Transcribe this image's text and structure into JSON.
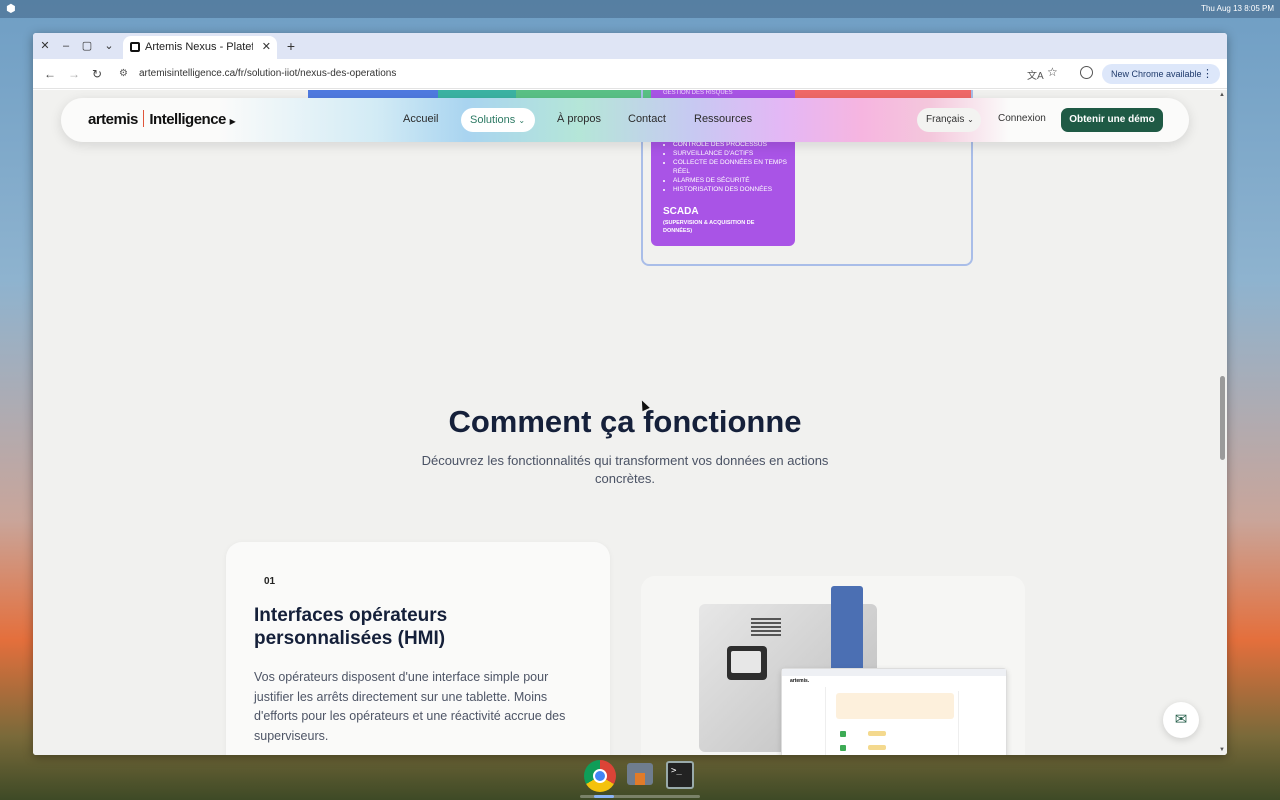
{
  "os": {
    "date": "Thu Aug 13",
    "time": "8:05 PM"
  },
  "browser": {
    "tab_title": "Artemis Nexus - Platefo",
    "url": "artemisintelligence.ca/fr/solution-iiot/nexus-des-operations",
    "update_label": "New Chrome available",
    "icons": {
      "close": "close-icon",
      "minimize": "minimize-icon",
      "maximize": "maximize-icon",
      "back": "back-arrow-icon",
      "forward": "forward-arrow-icon",
      "reload": "reload-icon"
    }
  },
  "diagram": {
    "top_fragment": "GESTION DES RISQUES",
    "scada_items": [
      "CONTRÔLE DES PROCESSUS",
      "SURVEILLANCE D'ACTIFS",
      "COLLECTE DE DONNÉES EN TEMPS RÉEL",
      "ALARMES DE SÉCURITÉ",
      "HISTORISATION DES DONNÉES"
    ],
    "scada_title": "SCADA",
    "scada_subtitle": "(SUPERVISION & ACQUISITION DE DONNÉES)",
    "colors": {
      "blue": "#4f7ae0",
      "teal": "#3bb3a3",
      "green": "#5ac186",
      "purple": "#a954e6",
      "red": "#f06868"
    }
  },
  "nav": {
    "logo_left": "artemis",
    "logo_right": "Intelligence",
    "links": {
      "home": "Accueil",
      "solutions": "Solutions",
      "about": "À propos",
      "contact": "Contact",
      "resources": "Ressources"
    },
    "language": "Français",
    "login": "Connexion",
    "demo": "Obtenir une démo"
  },
  "section": {
    "title": "Comment ça fonctionne",
    "subtitle": "Découvrez les fonctionnalités qui transforment vos données en actions concrètes."
  },
  "feature": {
    "number": "01",
    "title": "Interfaces opérateurs personnalisées (HMI)",
    "text": "Vos opérateurs disposent d'une interface simple pour justifier les arrêts directement sur une tablette. Moins d'efforts pour les opérateurs et une réactivité accrue des superviseurs."
  },
  "image_card": {
    "mock_logo": "artemis."
  },
  "theme": {
    "accent": "#1f5a45",
    "heading": "#15203a"
  }
}
